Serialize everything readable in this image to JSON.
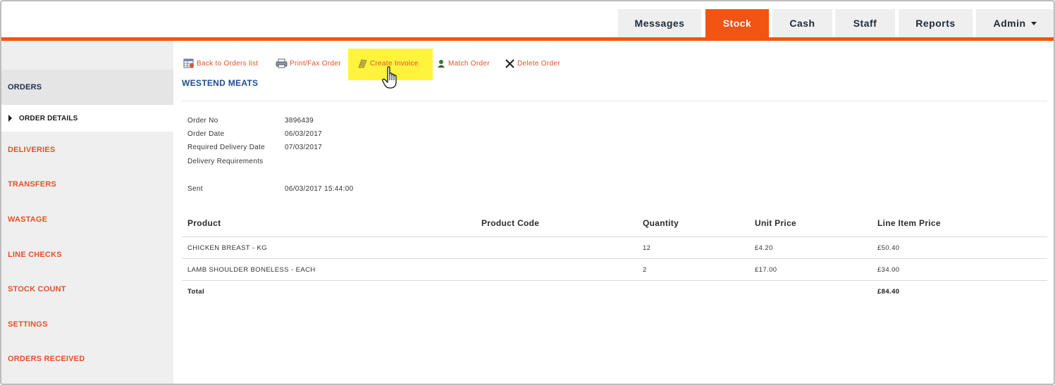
{
  "nav": {
    "tabs": [
      {
        "label": "Messages",
        "active": false
      },
      {
        "label": "Stock",
        "active": true
      },
      {
        "label": "Cash",
        "active": false
      },
      {
        "label": "Staff",
        "active": false
      },
      {
        "label": "Reports",
        "active": false
      },
      {
        "label": "Admin",
        "active": false,
        "dropdown": true
      }
    ],
    "accent_color": "#f25412"
  },
  "sidebar": {
    "items": [
      {
        "label": "ORDERS"
      },
      {
        "label": "ORDER DETAILS"
      },
      {
        "label": "DELIVERIES"
      },
      {
        "label": "TRANSFERS"
      },
      {
        "label": "WASTAGE"
      },
      {
        "label": "LINE CHECKS"
      },
      {
        "label": "STOCK COUNT"
      },
      {
        "label": "SETTINGS"
      },
      {
        "label": "ORDERS RECEIVED"
      }
    ]
  },
  "actions": [
    {
      "label": "Back to Orders list",
      "icon": "table-icon"
    },
    {
      "label": "Print/Fax Order",
      "icon": "printer-icon"
    },
    {
      "label": "Create Invoice",
      "icon": "invoice-icon",
      "highlighted": true
    },
    {
      "label": "Match Order",
      "icon": "person-icon"
    },
    {
      "label": "Delete Order",
      "icon": "x-icon"
    }
  ],
  "order": {
    "supplier": "WESTEND MEATS",
    "fields": [
      {
        "label": "Order No",
        "value": "3896439"
      },
      {
        "label": "Order Date",
        "value": "06/03/2017"
      },
      {
        "label": "Required Delivery Date",
        "value": "07/03/2017"
      },
      {
        "label": "Delivery Requirements",
        "value": ""
      },
      {
        "label": "Sent",
        "value": "06/03/2017 15:44:00"
      }
    ]
  },
  "table": {
    "columns": [
      "Product",
      "Product Code",
      "Quantity",
      "Unit Price",
      "Line Item Price"
    ],
    "rows": [
      {
        "product": "CHICKEN BREAST - KG",
        "code": "",
        "quantity": "12",
        "unit_price": "£4.20",
        "line_price": "£50.40"
      },
      {
        "product": "LAMB SHOULDER BONELESS - EACH",
        "code": "",
        "quantity": "2",
        "unit_price": "£17.00",
        "line_price": "£34.00"
      }
    ],
    "total_label": "Total",
    "total_value": "£84.40"
  }
}
